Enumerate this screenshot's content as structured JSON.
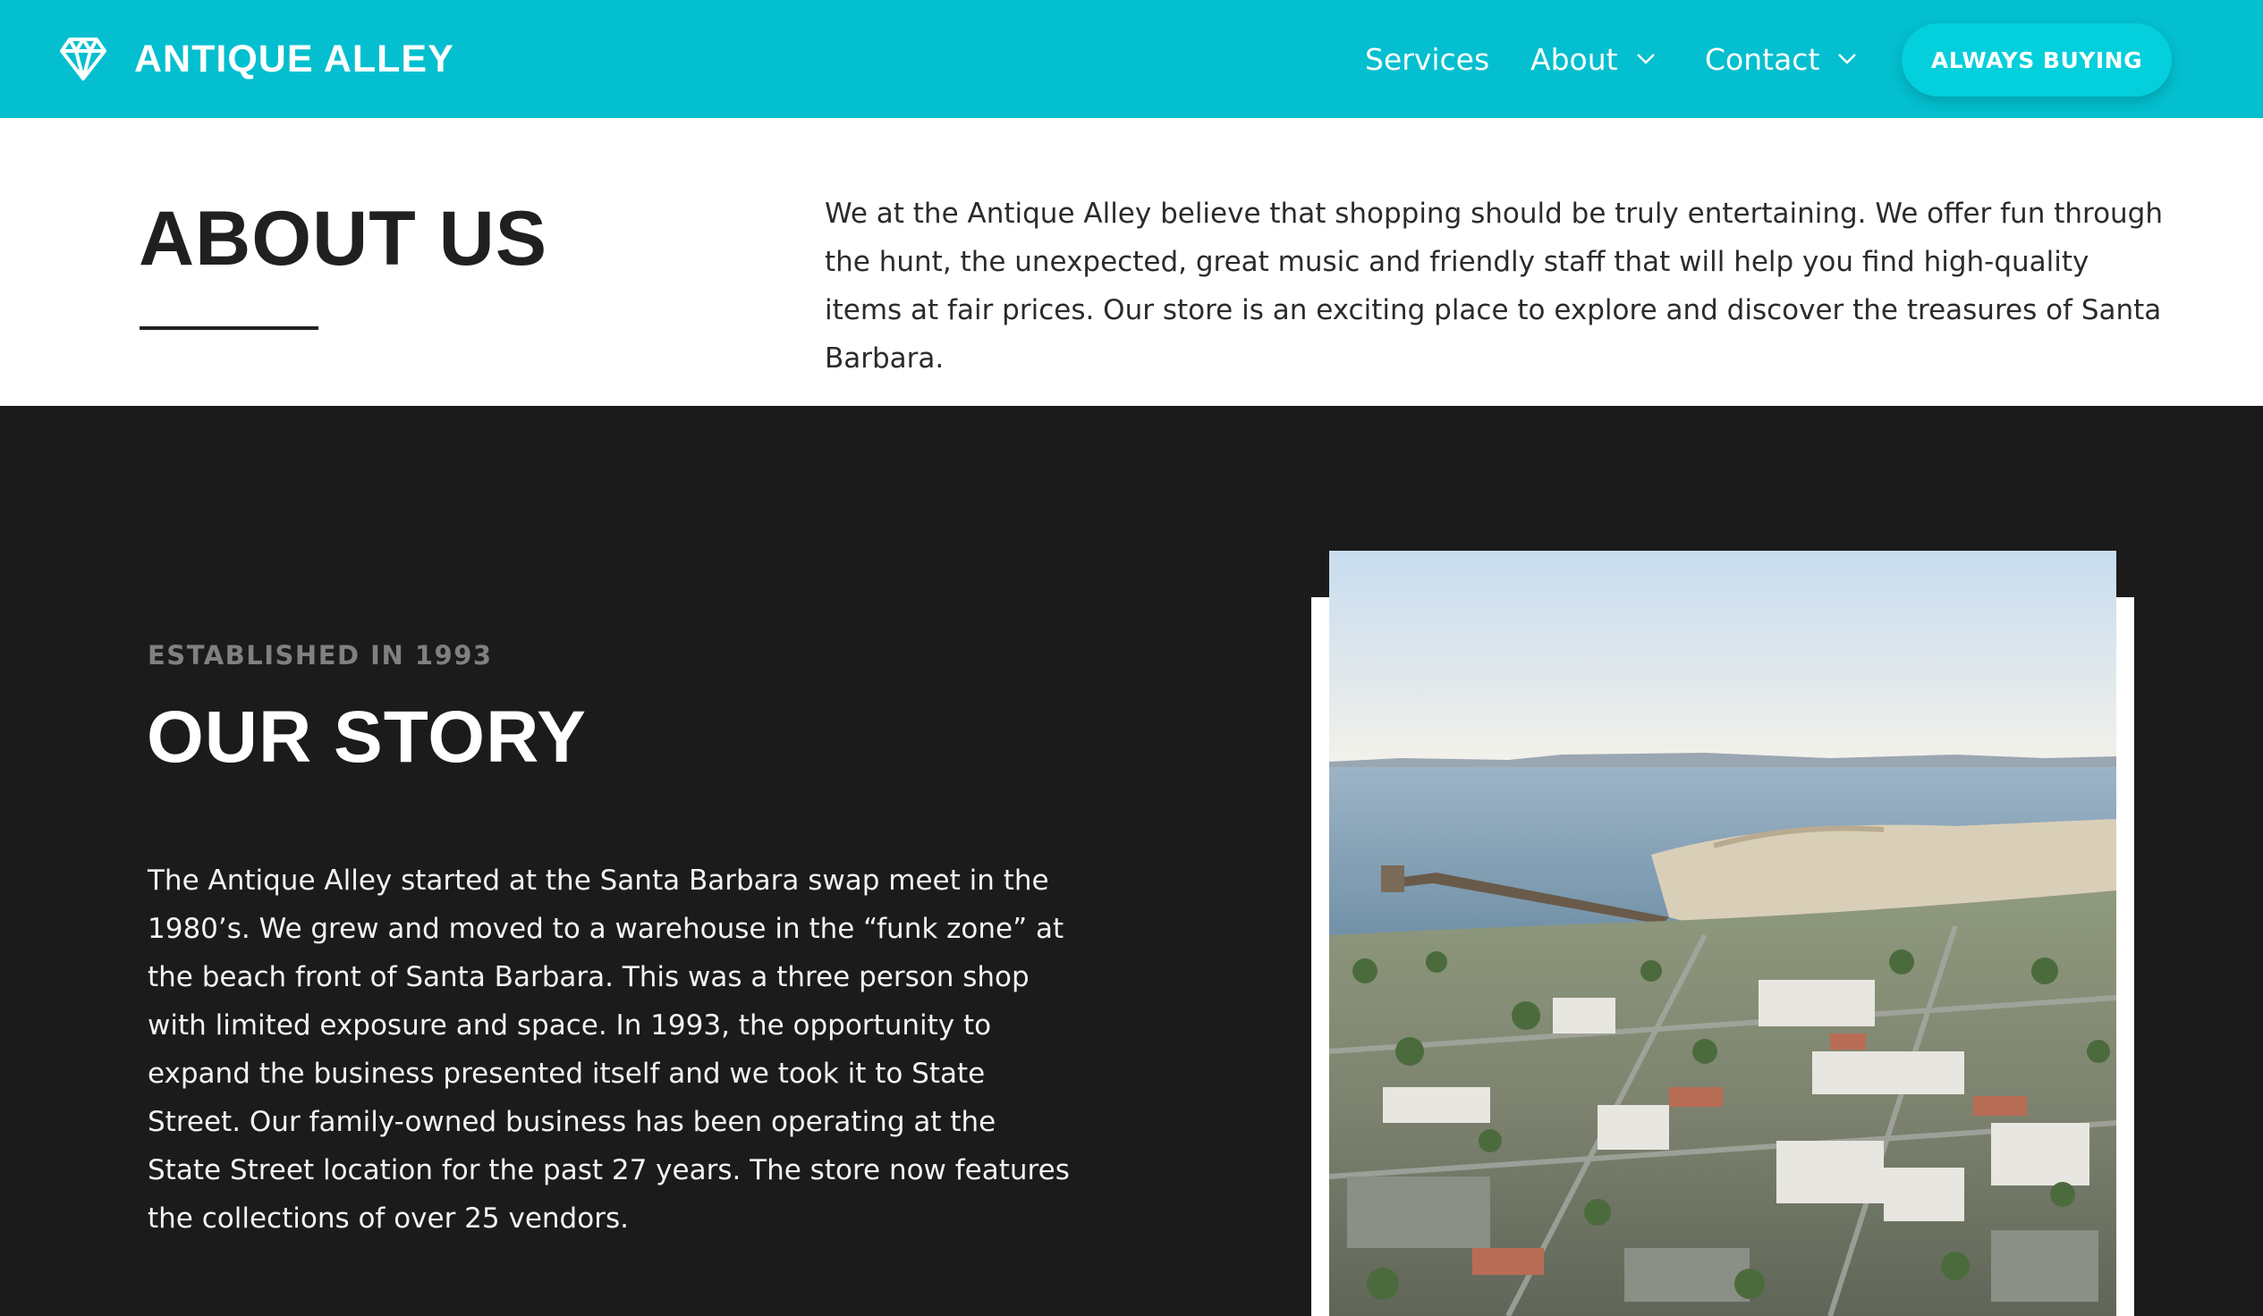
{
  "header": {
    "brand_name": "ANTIQUE ALLEY",
    "brand_icon": "diamond-icon",
    "nav": {
      "services_label": "Services",
      "about_label": "About",
      "contact_label": "Contact"
    },
    "cta_label": "ALWAYS BUYING"
  },
  "about": {
    "title": "ABOUT US",
    "body": "We at the Antique Alley believe that shopping should be truly entertaining. We offer fun through the hunt, the unexpected, great music and friendly staff that will help you find high-quality items at fair prices. Our store is an exciting place to explore and discover the treasures of Santa Barbara."
  },
  "story": {
    "eyebrow": "ESTABLISHED IN 1993",
    "title": "OUR STORY",
    "body": "The Antique Alley started at the Santa Barbara swap meet in the 1980’s. We grew and moved to a warehouse in the “funk zone” at the beach front of Santa Barbara. This was a three person shop with limited exposure and space. In 1993, the opportunity to expand the business presented itself and we took it to State Street. Our family-owned business has been operating at the State Street location for the past 27 years. The store now features the collections of over 25 vendors."
  },
  "colors": {
    "header_bg": "#03bfcf",
    "cta_bg": "#04cfdc",
    "dark_section_bg": "#1b1b1b",
    "eyebrow_text": "#808080"
  }
}
